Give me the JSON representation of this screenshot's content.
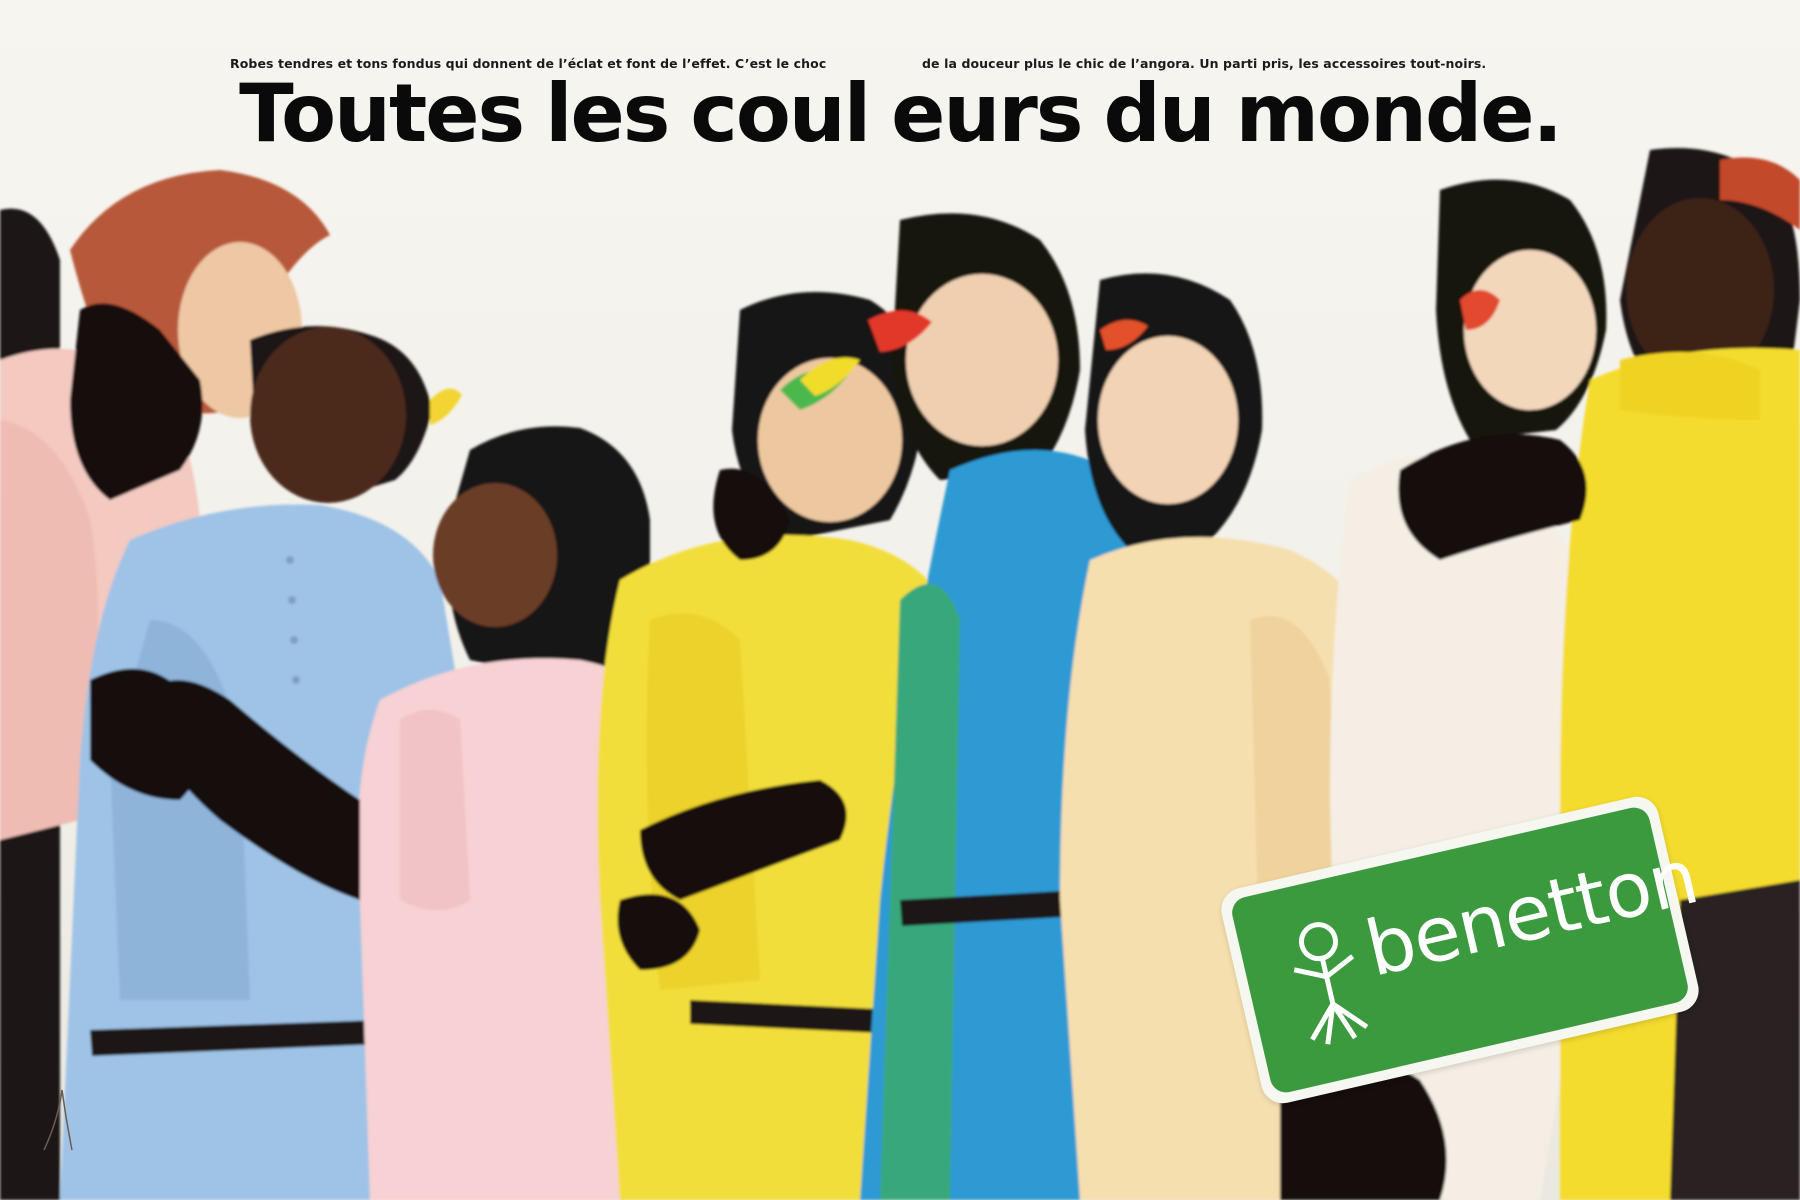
{
  "ad": {
    "kicker_left": "Robes tendres et tons fondus qui donnent de l’éclat et font de l’effet. C’est le choc",
    "kicker_right": "de la douceur plus le chic de l’angora. Un parti pris, les accessoires tout-noirs.",
    "headline_words": [
      "Toutes",
      "les",
      "coul",
      "eurs",
      "du",
      "monde."
    ]
  },
  "brand": {
    "name": "benetton",
    "logo_color": "#3c9a3e",
    "logo_border": "#f7f7f2"
  },
  "photo": {
    "subject": "group of eight models in pastel knit sweaters with black balaclavas and gloves",
    "garment_colors": [
      "#f3c9c0",
      "#9fc3e6",
      "#f7d1d3",
      "#f2de3a",
      "#2f9ad4",
      "#f6dfae",
      "#f5eee4",
      "#f4dc2f"
    ],
    "accessory_color": "#151210"
  }
}
